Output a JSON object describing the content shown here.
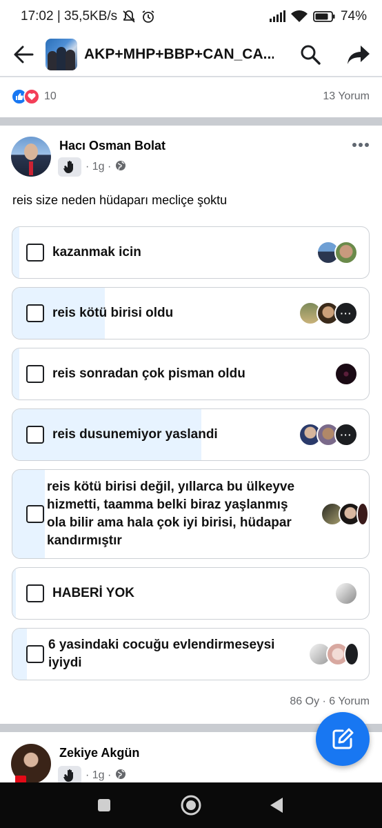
{
  "status_bar": {
    "time_speed": "17:02 | 35,5KB/s",
    "battery": "74%"
  },
  "app_bar": {
    "title": "AKP+MHP+BBP+CAN_CA..."
  },
  "reactions": {
    "count": "10",
    "comments": "13 Yorum"
  },
  "post": {
    "author": "Hacı Osman Bolat",
    "time": "· 1g ·",
    "text": "reis size neden hüdaparı mecliçe şoktu",
    "options": [
      {
        "label": "kazanmak icin",
        "fill_pct": 2
      },
      {
        "label": "reis kötü birisi oldu",
        "fill_pct": 26
      },
      {
        "label": "reis sonradan çok pisman oldu",
        "fill_pct": 2
      },
      {
        "label": "reis dusunemiyor yaslandi",
        "fill_pct": 53
      },
      {
        "label": "reis kötü birisi değil, yıllarca bu ülkeyve hizmetti, taamma belki biraz yaşlanmış ola bilir ama hala çok iyi birisi, hüdapar kandırmıştır",
        "fill_pct": 9
      },
      {
        "label": "HABERİ YOK",
        "fill_pct": 1
      },
      {
        "label": "6 yasindaki cocuğu evlendirmeseysi iyiydi",
        "fill_pct": 4
      }
    ],
    "votes_line": "86 Oy · 6 Yorum"
  },
  "post2": {
    "author": "Zekiye Akgün",
    "time": "· 1g ·"
  },
  "colors": {
    "accent": "#1877f2",
    "poll_fill": "#e7f3ff"
  }
}
